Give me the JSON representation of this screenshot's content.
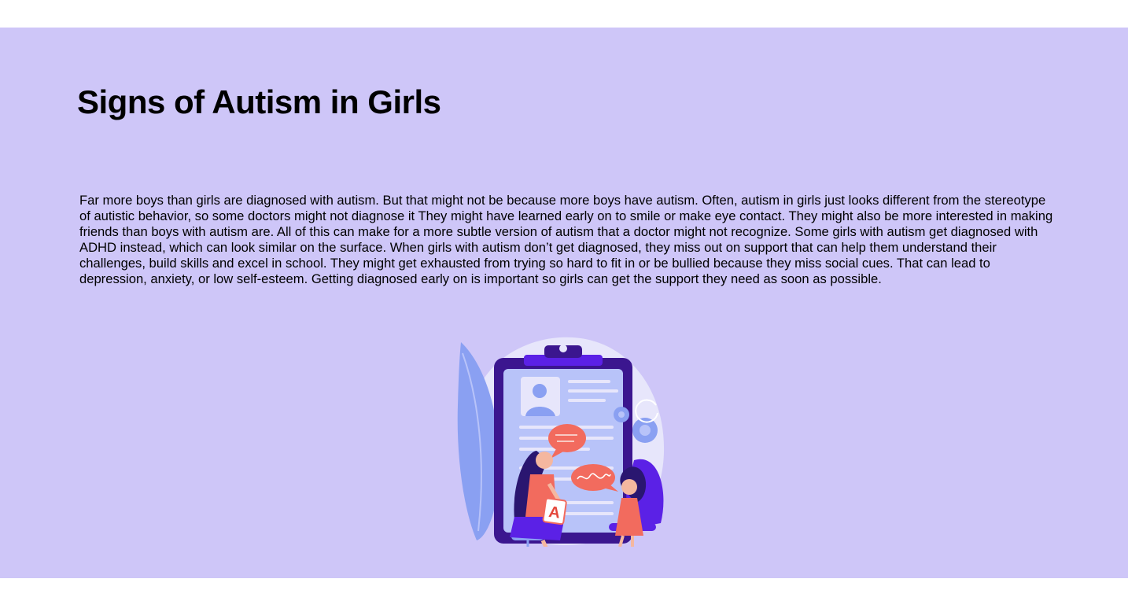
{
  "page": {
    "title": "Signs of Autism in Girls",
    "body": "Far more boys than girls are diagnosed with autism. But that might not be because more boys have autism. Often, autism in girls just looks different from the stereotype of autistic behavior, so some doctors might not diagnose it They might have learned early on to smile or make eye contact. They might also be more interested in making friends than boys with autism are. All of this can make for a more subtle version of autism that a doctor might not recognize. Some girls with autism get diagnosed with ADHD instead, which can look similar on the surface. When girls with autism don’t get diagnosed, they miss out on support that can help them understand their challenges, build skills and excel in school. They might get exhausted from trying so hard to fit in or be bullied because they miss social cues. That can lead to depression, anxiety, or low self-esteem. Getting diagnosed early on is important so girls can get the support they need as soon as possible."
  },
  "illustration": {
    "card_letter": "A",
    "colors": {
      "background": "#cec6f8",
      "blob": "#e7e6fb",
      "clipboard": "#3b168f",
      "paper": "#b8c3f9",
      "accent_purple": "#5b21e6",
      "coral": "#f26b5e",
      "blue": "#8aa0f2",
      "hair": "#2a1670"
    }
  }
}
